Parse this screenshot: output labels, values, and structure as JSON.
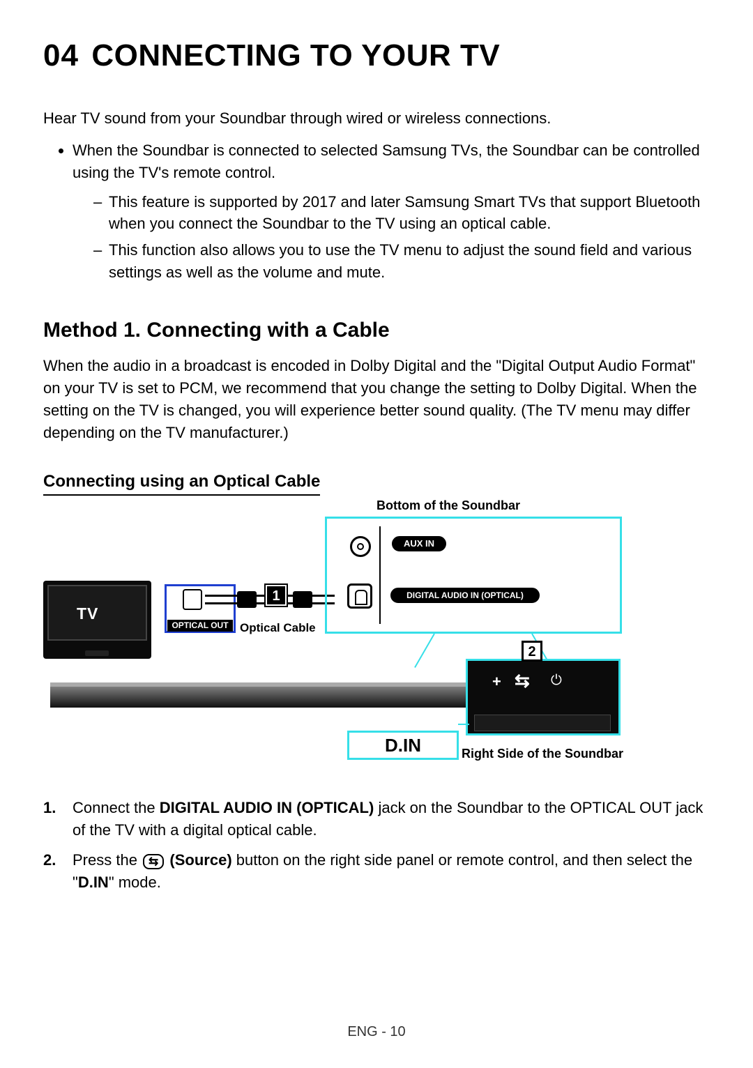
{
  "chapter": {
    "num": "04",
    "title": "CONNECTING TO YOUR TV"
  },
  "intro": "Hear TV sound from your Soundbar through wired or wireless connections.",
  "bullet": {
    "main": "When the Soundbar is connected to selected Samsung TVs, the Soundbar can be controlled using the TV's remote control.",
    "sub1": "This feature is supported by 2017 and later Samsung Smart TVs that support Bluetooth when you connect the Soundbar to the TV using an optical cable.",
    "sub2": "This function also allows you to use the TV menu to adjust the sound field and various settings as well as the volume and mute."
  },
  "method": {
    "title": "Method 1. Connecting with a Cable",
    "body": "When the audio in a broadcast is encoded in Dolby Digital and the \"Digital Output Audio Format\" on your TV is set to PCM, we recommend that you change the setting to Dolby Digital. When the setting on the TV is changed, you will experience better sound quality. (The TV menu may differ depending on the TV manufacturer.)"
  },
  "sub": "Connecting using an Optical Cable",
  "diagram": {
    "bottom_label": "Bottom of the Soundbar",
    "tv": "TV",
    "optical_out": "OPTICAL OUT",
    "cable": "Optical Cable",
    "step1": "1",
    "aux": "AUX IN",
    "din_port": "DIGITAL AUDIO IN (OPTICAL)",
    "step2": "2",
    "din_flag": "D.IN",
    "right_label": "Right Side of the Soundbar",
    "plus": "+",
    "minus": "−",
    "source_glyph": "⇆",
    "power_glyph": "⏻"
  },
  "steps": {
    "n1": "1.",
    "n2": "2.",
    "s1a": "Connect the ",
    "s1b": "DIGITAL AUDIO IN (OPTICAL)",
    "s1c": " jack on the Soundbar to the OPTICAL OUT jack of the TV with a digital optical cable.",
    "s2a": "Press the ",
    "s2icon": "⇆",
    "s2b": " (Source)",
    "s2c": " button on the right side panel or remote control, and then select the \"",
    "s2d": "D.IN",
    "s2e": "\" mode."
  },
  "footer": "ENG - 10"
}
